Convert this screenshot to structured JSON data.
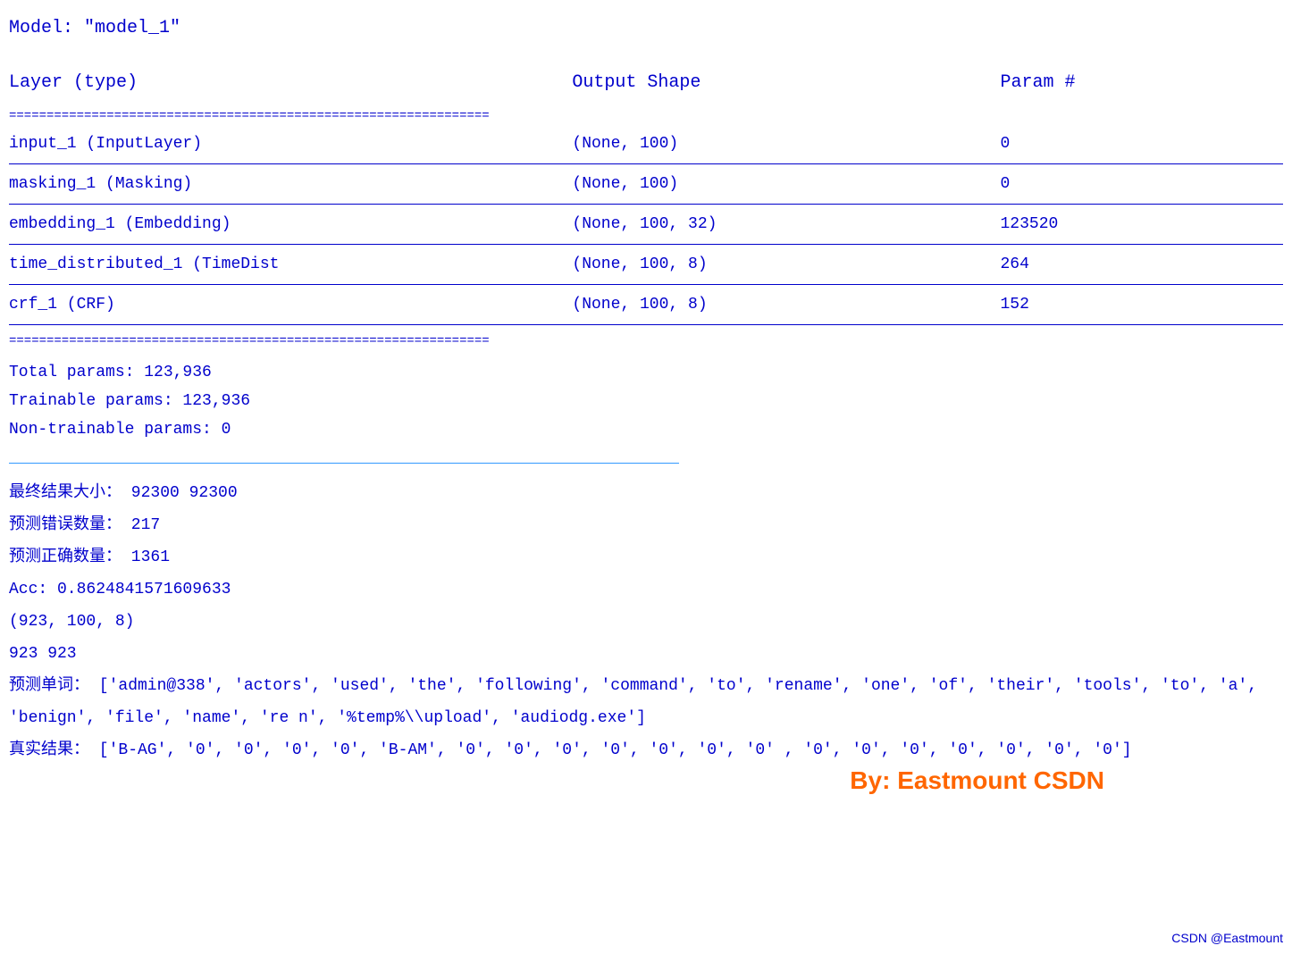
{
  "model": {
    "title": "Model: \"model_1\"",
    "table": {
      "headers": [
        "Layer (type)",
        "Output Shape",
        "Param #"
      ],
      "rows": [
        {
          "layer": "input_1 (InputLayer)",
          "output": "(None, 100)",
          "params": "0"
        },
        {
          "layer": "masking_1 (Masking)",
          "output": "(None, 100)",
          "params": "0"
        },
        {
          "layer": "embedding_1 (Embedding)",
          "output": "(None, 100, 32)",
          "params": "123520"
        },
        {
          "layer": "time_distributed_1 (TimeDist",
          "output": "(None, 100, 8)",
          "params": "264"
        },
        {
          "layer": "crf_1 (CRF)",
          "output": "(None, 100, 8)",
          "params": "152"
        }
      ]
    },
    "params": {
      "total": "Total params: 123,936",
      "trainable": "Trainable params: 123,936",
      "non_trainable": "Non-trainable params: 0"
    }
  },
  "results": {
    "final_size": "最终结果大小： 92300  92300",
    "prediction_errors": "预测错误数量： 217",
    "prediction_correct": "预测正确数量： 1361",
    "acc": "Acc: 0.8624841571609633",
    "shape": "(923,  100,  8)",
    "count": "923  923",
    "predicted_words": "预测单词：  ['admin@338',  'actors',  'used',  'the',  'following',  'command',  'to',  'rename',  'one',  'of',  'their',  'tools',  'to',  'a',  'benign',  'file',  'name',  're n',  '%temp%\\\\upload',  'audiodg.exe']",
    "true_result": "真实结果：  ['B-AG',  '0',  '0',  '0',  '0',  'B-AM',  '0',  '0',  '0',  '0',  '0',  '0',  '0'  ,  '0',  '0',  '0',  '0',  '0',  '0',  '0']"
  },
  "watermark": "By:  Eastmount CSDN",
  "bottom_watermark": "CSDN @Eastmount",
  "equals_char": "================================================================"
}
